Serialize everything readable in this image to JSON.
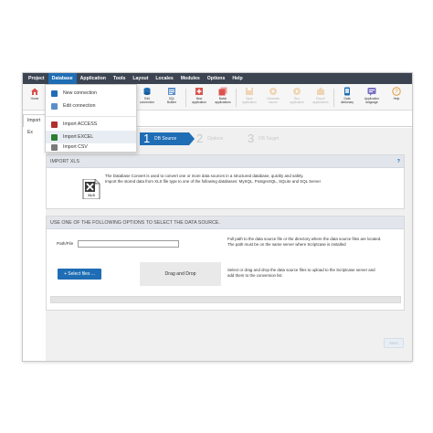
{
  "menubar": {
    "items": [
      "Project",
      "Database",
      "Application",
      "Tools",
      "Layout",
      "Locales",
      "Modules",
      "Options",
      "Help"
    ],
    "active_index": 1,
    "color": "#3c4452",
    "active_color": "#1f6db5"
  },
  "toolbar": {
    "home": "Home",
    "edit_connection": "Edit\nconnection",
    "sql_builder": "SQL\nBuilder",
    "new_application": "New\napplication",
    "batch_applications": "Batch\napplications",
    "save_application": "Save\napplication",
    "generate_source": "Generate\nsource",
    "run_application": "Run\napplication",
    "export_applications": "Export\napplications",
    "data_dictionary": "Data\ndictionary",
    "application_language": "Application\nlanguage",
    "help": "Help"
  },
  "dropdown": {
    "items": [
      "New connection",
      "Edit connection",
      "Import ACCESS",
      "Import EXCEL",
      "Import CSV"
    ],
    "hover_index": 3
  },
  "tab": {
    "label": "Import Ex"
  },
  "steps": [
    {
      "num": "1",
      "label": "DB Source"
    },
    {
      "num": "2",
      "label": "Options"
    },
    {
      "num": "3",
      "label": "DB Target"
    }
  ],
  "import_panel": {
    "title": "IMPORT XLS",
    "help": "?",
    "icon_text": "XLS",
    "desc_line1": "The Database Convert is used to convert one or more data sources in a structured database, quickly and safely.",
    "desc_line2": "Import the stored data from XLS file type to one of the following databases: MySQL, PostgreSQL, SQLite and SQL Server"
  },
  "source_panel": {
    "title": "USE ONE OF THE FOLLOWING OPTIONS TO SELECT THE DATA SOURCE.",
    "path_label": "Path/File",
    "path_value": "",
    "path_help_line1": "Full path to the data source file or the directory where the data source files are located.",
    "path_help_line2": "The path must be on the same server where Scriptcase is installed",
    "select_button": "+ Select files ...",
    "drop_zone": "Drag and Drop",
    "drop_help_line1": "Select or drag and drop the data source files to upload to the Scriptcase server and",
    "drop_help_line2": "add them to the conversion list"
  },
  "next_button": "Next"
}
